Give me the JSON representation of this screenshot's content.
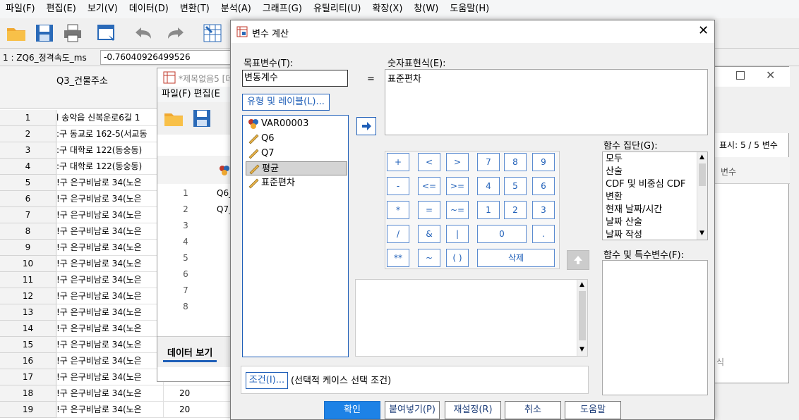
{
  "menubar": {
    "items": [
      "파일(F)",
      "편집(E)",
      "보기(V)",
      "데이터(D)",
      "변환(T)",
      "분석(A)",
      "그래프(G)",
      "유틸리티(U)",
      "확장(X)",
      "창(W)",
      "도움말(H)"
    ]
  },
  "cellrow": {
    "ref": "1 : ZQ6_정격속도_ms",
    "value": "-0.76040926499526"
  },
  "grid": {
    "column_header": "Q3_건물주소",
    "rows": [
      {
        "n": "1",
        "addr": "l 송악읍 신복운로6길 1",
        "c2": ""
      },
      {
        "n": "2",
        "addr": ":구 동교로 162-5(서교동",
        "c2": ""
      },
      {
        "n": "3",
        "addr": ":구 대학로 122(동숭동)",
        "c2": ""
      },
      {
        "n": "4",
        "addr": ":구 대학로 122(동숭동)",
        "c2": ""
      },
      {
        "n": "5",
        "addr": "!구 은구비남로 34(노은",
        "c2": ""
      },
      {
        "n": "6",
        "addr": "!구 은구비남로 34(노은",
        "c2": ""
      },
      {
        "n": "7",
        "addr": "!구 은구비남로 34(노은",
        "c2": ""
      },
      {
        "n": "8",
        "addr": "!구 은구비남로 34(노은",
        "c2": ""
      },
      {
        "n": "9",
        "addr": "!구 은구비남로 34(노은",
        "c2": ""
      },
      {
        "n": "10",
        "addr": "!구 은구비남로 34(노은",
        "c2": ""
      },
      {
        "n": "11",
        "addr": "!구 은구비남로 34(노은",
        "c2": ""
      },
      {
        "n": "12",
        "addr": "!구 은구비남로 34(노은",
        "c2": ""
      },
      {
        "n": "13",
        "addr": "!구 은구비남로 34(노은",
        "c2": ""
      },
      {
        "n": "14",
        "addr": "!구 은구비남로 34(노은",
        "c2": ""
      },
      {
        "n": "15",
        "addr": "!구 은구비남로 34(노은",
        "c2": ""
      },
      {
        "n": "16",
        "addr": "!구 은구비남로 34(노은",
        "c2": ""
      },
      {
        "n": "17",
        "addr": "!구 은구비남로 34(노은",
        "c2": ""
      },
      {
        "n": "18",
        "addr": "!구 은구비남로 34(노은",
        "c2": "20"
      },
      {
        "n": "19",
        "addr": "!구 은구비남로 34(노은",
        "c2": "20"
      }
    ]
  },
  "win2": {
    "title": "*제목없음5 [데",
    "menu": "파일(F)   편집(E",
    "rows": [
      {
        "n": "1",
        "v": "Q6_"
      },
      {
        "n": "2",
        "v": "Q7_"
      },
      {
        "n": "3",
        "v": ""
      },
      {
        "n": "4",
        "v": ""
      },
      {
        "n": "5",
        "v": ""
      },
      {
        "n": "6",
        "v": ""
      },
      {
        "n": "7",
        "v": ""
      },
      {
        "n": "8",
        "v": ""
      }
    ],
    "tab_data": "데이터 보기",
    "bottom_rows": [
      "1",
      "2"
    ]
  },
  "win3": {
    "show": "표시: 5 / 5 변수",
    "var_header": "변수",
    "more": "식"
  },
  "dialog": {
    "title": "변수 계산",
    "target_label": "목표변수(T):",
    "target_value": "변동계수",
    "equals": "=",
    "type_label_button": "유형 및 레이블(L)...",
    "expression_label": "숫자표현식(E):",
    "expression_value": "표준편차",
    "variables": [
      {
        "name": "VAR00003",
        "icon": "string-var-icon"
      },
      {
        "name": "Q6",
        "icon": "scale-ruler-icon"
      },
      {
        "name": "Q7",
        "icon": "scale-ruler-icon"
      },
      {
        "name": "평균",
        "icon": "scale-ruler-icon"
      },
      {
        "name": "표준편차",
        "icon": "scale-ruler-icon"
      }
    ],
    "keypad": [
      [
        "+",
        "<",
        ">",
        "7",
        "8",
        "9"
      ],
      [
        "-",
        "<=",
        ">=",
        "4",
        "5",
        "6"
      ],
      [
        "*",
        "=",
        "~=",
        "1",
        "2",
        "3"
      ],
      [
        "/",
        "&",
        "|",
        "0",
        "."
      ],
      [
        "**",
        "~",
        "( )",
        "삭제"
      ]
    ],
    "function_group_label": "함수 집단(G):",
    "function_groups": [
      "모두",
      "산술",
      "CDF 및 비중심 CDF",
      "변환",
      "현재 날짜/시간",
      "날짜 산술",
      "날짜 작성"
    ],
    "functions_label": "함수 및 특수변수(F):",
    "condition_button": "조건(I)...",
    "condition_text": "(선택적 케이스 선택 조건)",
    "buttons": {
      "ok": "확인",
      "paste": "붙여넣기(P)",
      "reset": "재설정(R)",
      "cancel": "취소",
      "help": "도움말"
    }
  },
  "colors": {
    "accent": "#1f5fb8",
    "primary_button": "#1d82e6"
  }
}
